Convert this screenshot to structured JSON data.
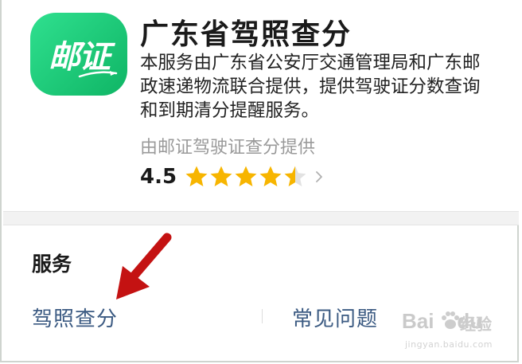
{
  "app": {
    "logo_text": "邮证",
    "title": "广东省驾照查分",
    "description": "本服务由广东省公安厅交通管理局和广东邮政速递物流联合提供，提供驾驶证分数查询和到期清分提醒服务。",
    "provider": "由邮证驾驶证查分提供",
    "rating": {
      "value_label": "4.5",
      "value": 4.5,
      "max": 5
    }
  },
  "services": {
    "section_title": "服务",
    "items": [
      {
        "label": "驾照查分"
      },
      {
        "label": "常见问题"
      }
    ]
  },
  "watermark": {
    "brand": "Bai",
    "brand_tail": "du",
    "jingyan": "经验",
    "url": "jingyan.baidu.com"
  },
  "colors": {
    "logo_green": "#16c06f",
    "star_filled": "#f7b500",
    "star_empty": "#e2e2e2",
    "link_blue": "#3b5a82",
    "arrow_red": "#c41212"
  },
  "icons": {
    "rating_chevron": "chevron-right-icon",
    "annotation": "red-arrow-icon"
  }
}
